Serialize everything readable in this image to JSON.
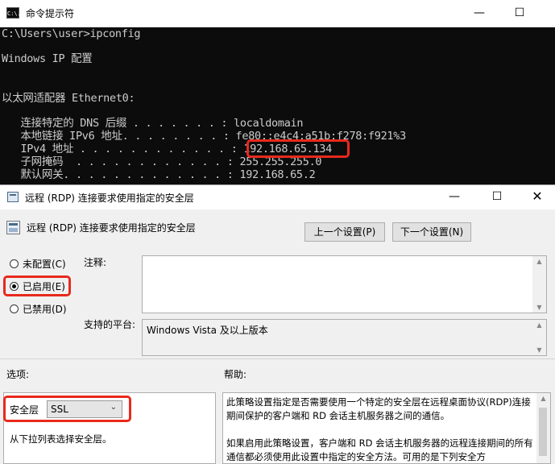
{
  "cmd": {
    "title": "命令提示符",
    "icon_text": "C:\\.",
    "min": "—",
    "max": "☐",
    "lines": [
      "C:\\Users\\user>ipconfig",
      "Windows IP 配置",
      "以太网适配器 Ethernet0:",
      "   连接特定的 DNS 后缀 . . . . . . . : localdomain",
      "   本地链接 IPv6 地址. . . . . . . . : fe80::e4c4:a51b:f278:f921%3",
      "   IPv4 地址 . . . . . . . . . . . . : 192.168.65.134",
      "   子网掩码  . . . . . . . . . . . . : 255.255.255.0",
      "   默认网关. . . . . . . . . . . . . : 192.168.65.2"
    ]
  },
  "dialog": {
    "title": "远程 (RDP) 连接要求使用指定的安全层",
    "header": "远程 (RDP) 连接要求使用指定的安全层",
    "min": "—",
    "max": "☐",
    "close": "✕",
    "prev_button": "上一个设置(P)",
    "next_button": "下一个设置(N)",
    "radios": [
      {
        "label": "未配置(C)",
        "checked": false
      },
      {
        "label": "已启用(E)",
        "checked": true
      },
      {
        "label": "已禁用(D)",
        "checked": false
      }
    ],
    "comment_label": "注释:",
    "comment_value": "",
    "platform_label": "支持的平台:",
    "platform_value": "Windows Vista 及以上版本",
    "options_label": "选项:",
    "help_label": "帮助:",
    "security_layer_label": "安全层",
    "security_layer_value": "SSL",
    "options_hint": "从下拉列表选择安全层。",
    "help_text_1": "此策略设置指定是否需要使用一个特定的安全层在远程桌面协议(RDP)连接期间保护的客户端和 RD 会话主机服务器之间的通信。",
    "help_text_2": "如果启用此策略设置，客户端和 RD 会话主机服务器的远程连接期间的所有通信都必须使用此设置中指定的安全方法。可用的是下列安全方"
  },
  "colors": {
    "highlight": "#e8291c",
    "console_bg": "#0c0c0c",
    "console_fg": "#cccccc"
  }
}
